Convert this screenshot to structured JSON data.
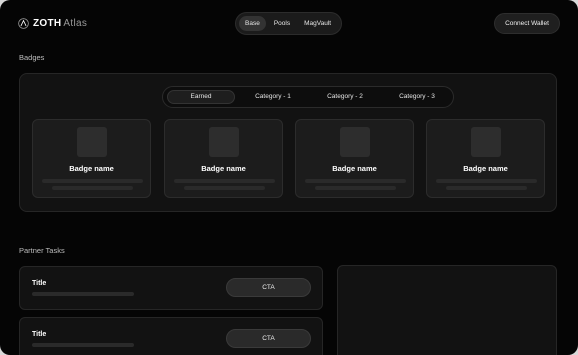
{
  "header": {
    "logo_brand": "ZOTH",
    "logo_sub": "Atlas",
    "nav": [
      {
        "label": "Base",
        "active": true
      },
      {
        "label": "Pools",
        "active": false
      },
      {
        "label": "MagVault",
        "active": false
      }
    ],
    "connect_label": "Connect Wallet"
  },
  "badges": {
    "section_title": "Badges",
    "tabs": [
      {
        "label": "Earned",
        "active": true
      },
      {
        "label": "Category - 1",
        "active": false
      },
      {
        "label": "Category - 2",
        "active": false
      },
      {
        "label": "Category - 3",
        "active": false
      }
    ],
    "cards": [
      {
        "name": "Badge name"
      },
      {
        "name": "Badge name"
      },
      {
        "name": "Badge name"
      },
      {
        "name": "Badge name"
      }
    ]
  },
  "partner_tasks": {
    "section_title": "Partner Tasks",
    "tasks": [
      {
        "title": "Title",
        "cta": "CTA"
      },
      {
        "title": "Title",
        "cta": "CTA"
      }
    ]
  },
  "colors": {
    "background": "#050505",
    "panel": "#121212",
    "card": "#1c1c1c",
    "text": "#ffffff",
    "muted_text": "#bdbdbd"
  }
}
